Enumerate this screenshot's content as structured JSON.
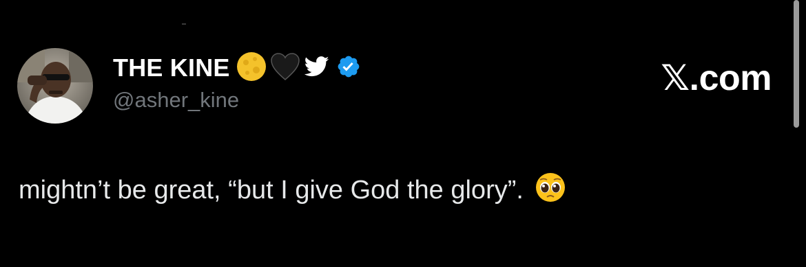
{
  "tweet": {
    "author": {
      "display_name": "THE KINE",
      "handle": "@asher_kine",
      "verified": true,
      "name_badges": [
        "full-moon-emoji",
        "black-heart-emoji",
        "twitter-bird-icon"
      ]
    },
    "body": {
      "text": "mightn’t be great, “but I give God the glory”.",
      "trailing_emoji": "pleading-face-emoji"
    }
  },
  "brand": {
    "label": "𝕏.com"
  },
  "colors": {
    "background": "#000000",
    "text_primary": "#e7e9ea",
    "text_secondary": "#71767b",
    "verified_blue": "#1d9bf0",
    "twitter_blue": "#1d9bf0"
  }
}
